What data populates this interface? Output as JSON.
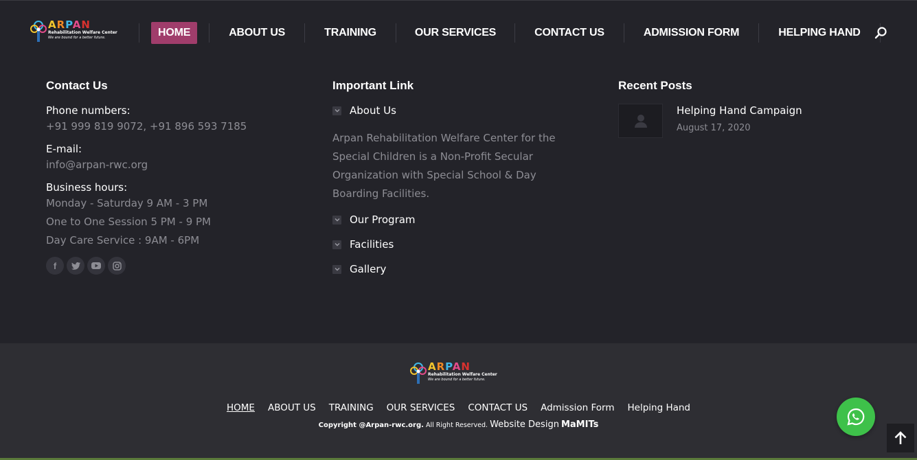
{
  "header": {
    "logo": {
      "word": [
        "A",
        "R",
        "P",
        "A",
        "N"
      ],
      "sub": "Rehabilitation Welfare Center",
      "tag": "We are bound for a better future."
    },
    "nav": [
      "HOME",
      "ABOUT US",
      "TRAINING",
      "OUR SERVICES",
      "CONTACT US",
      "ADMISSION FORM",
      "HELPING HAND"
    ],
    "active_nav": "HOME",
    "search_icon": "search-icon"
  },
  "contact": {
    "title": "Contact Us",
    "phone_label": "Phone numbers:",
    "phone_value": "+91 999 819 9072, +91 896 593 7185",
    "email_label": "E-mail:",
    "email_value": "info@arpan-rwc.org",
    "hours_label": "Business hours:",
    "hours": [
      "Monday - Saturday 9 AM - 3 PM",
      "One to One Session 5 PM - 9 PM",
      "Day Care Service : 9AM - 6PM"
    ],
    "social_icons": [
      "facebook-icon",
      "twitter-icon",
      "youtube-icon",
      "instagram-icon"
    ]
  },
  "links": {
    "title": "Important Link",
    "first": "About Us",
    "description": "Arpan Rehabilitation Welfare Center for the Special Children is a Non-Profit Secular Organization with Special School & Day Boarding Facilities.",
    "rest": [
      "Our Program",
      "Facilities",
      "Gallery"
    ]
  },
  "recent": {
    "title": "Recent Posts",
    "posts": [
      {
        "title": "Helping Hand Campaign",
        "date": "August 17, 2020"
      }
    ]
  },
  "bottom": {
    "nav": [
      "HOME",
      "ABOUT US",
      "TRAINING",
      "OUR SERVICES",
      "CONTACT US",
      "Admission Form",
      "Helping Hand"
    ],
    "copyright_bold": "Copyright @Arpan-rwc.org.",
    "copyright_rest": "All Right Reserved.",
    "design_label": "Website Design",
    "design_brand": "MaMITs"
  },
  "colors": {
    "background": "#232329",
    "bottom_bar": "#2e2e33",
    "accent": "#a03d6b",
    "whatsapp": "#3ec14a",
    "muted_text": "#8d8d94"
  }
}
